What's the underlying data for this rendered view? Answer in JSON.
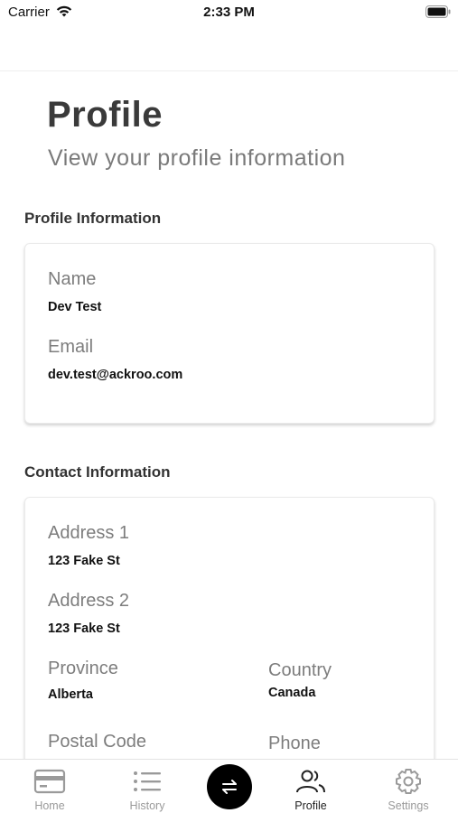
{
  "status_bar": {
    "carrier": "Carrier",
    "time": "2:33 PM"
  },
  "header": {
    "title": "Profile",
    "subtitle": "View your profile information"
  },
  "profile_section": {
    "title": "Profile Information",
    "name_label": "Name",
    "name_value": "Dev Test",
    "email_label": "Email",
    "email_value": "dev.test@ackroo.com"
  },
  "contact_section": {
    "title": "Contact Information",
    "address1_label": "Address 1",
    "address1_value": "123 Fake St",
    "address2_label": "Address 2",
    "address2_value": "123 Fake St",
    "province_label": "Province",
    "province_value": "Alberta",
    "country_label": "Country",
    "country_value": "Canada",
    "postal_label": "Postal Code",
    "phone_label": "Phone"
  },
  "tab_bar": {
    "home": "Home",
    "history": "History",
    "profile": "Profile",
    "settings": "Settings",
    "active": "profile"
  },
  "icons": {
    "home": "wallet-card-icon",
    "history": "list-icon",
    "center": "swap-arrows-icon",
    "profile": "users-icon",
    "settings": "gear-icon"
  }
}
